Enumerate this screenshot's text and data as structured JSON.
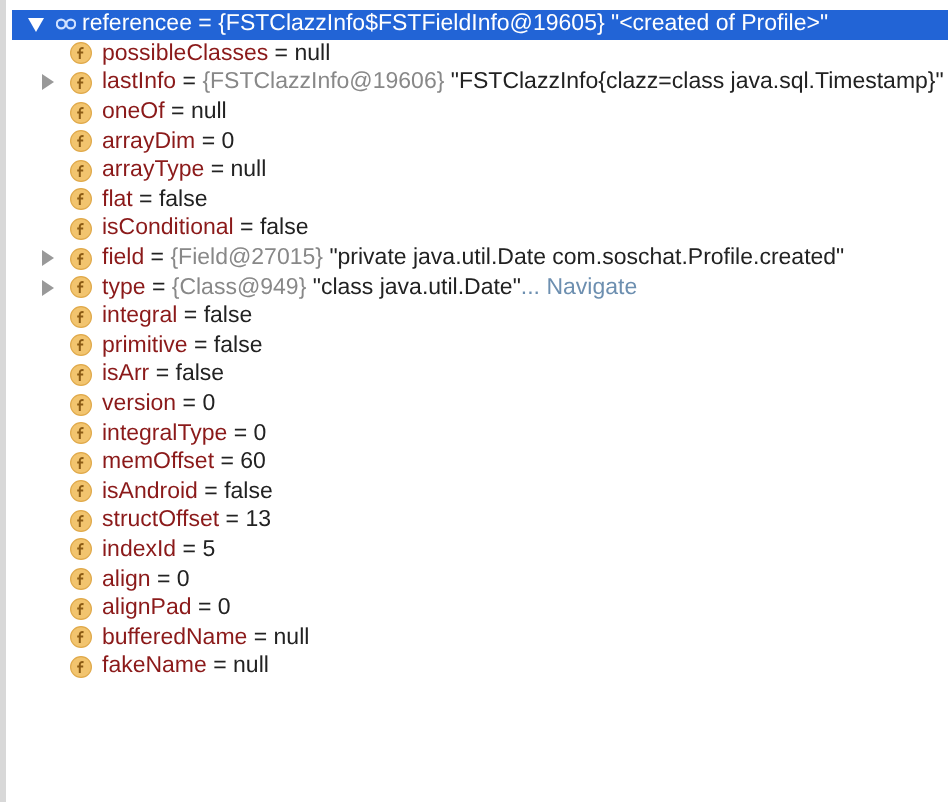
{
  "root": {
    "name": "referencee",
    "sep": "=",
    "ref": "{FSTClazzInfo$FSTFieldInfo@19605}",
    "string": "\"<created of Profile>\"",
    "expanded": true,
    "selected": true,
    "children": [
      {
        "kind": "leaf",
        "name": "possibleClasses",
        "value": "null"
      },
      {
        "kind": "object",
        "expanded": false,
        "name": "lastInfo",
        "ref": "{FSTClazzInfo@19606}",
        "string": "\"FSTClazzInfo{clazz=class java.sql.Timestamp}\""
      },
      {
        "kind": "leaf",
        "name": "oneOf",
        "value": "null"
      },
      {
        "kind": "leaf",
        "name": "arrayDim",
        "value": "0"
      },
      {
        "kind": "leaf",
        "name": "arrayType",
        "value": "null"
      },
      {
        "kind": "leaf",
        "name": "flat",
        "value": "false"
      },
      {
        "kind": "leaf",
        "name": "isConditional",
        "value": "false"
      },
      {
        "kind": "object",
        "expanded": false,
        "name": "field",
        "ref": "{Field@27015}",
        "string": "\"private java.util.Date com.soschat.Profile.created\""
      },
      {
        "kind": "object",
        "expanded": false,
        "name": "type",
        "ref": "{Class@949}",
        "string": "\"class java.util.Date\"",
        "ellipsis": "...",
        "link": "Navigate"
      },
      {
        "kind": "leaf",
        "name": "integral",
        "value": "false"
      },
      {
        "kind": "leaf",
        "name": "primitive",
        "value": "false"
      },
      {
        "kind": "leaf",
        "name": "isArr",
        "value": "false"
      },
      {
        "kind": "leaf",
        "name": "version",
        "value": "0"
      },
      {
        "kind": "leaf",
        "name": "integralType",
        "value": "0"
      },
      {
        "kind": "leaf",
        "name": "memOffset",
        "value": "60"
      },
      {
        "kind": "leaf",
        "name": "isAndroid",
        "value": "false"
      },
      {
        "kind": "leaf",
        "name": "structOffset",
        "value": "13"
      },
      {
        "kind": "leaf",
        "name": "indexId",
        "value": "5"
      },
      {
        "kind": "leaf",
        "name": "align",
        "value": "0"
      },
      {
        "kind": "leaf",
        "name": "alignPad",
        "value": "0"
      },
      {
        "kind": "leaf",
        "name": "bufferedName",
        "value": "null"
      },
      {
        "kind": "leaf",
        "name": "fakeName",
        "value": "null"
      }
    ]
  }
}
